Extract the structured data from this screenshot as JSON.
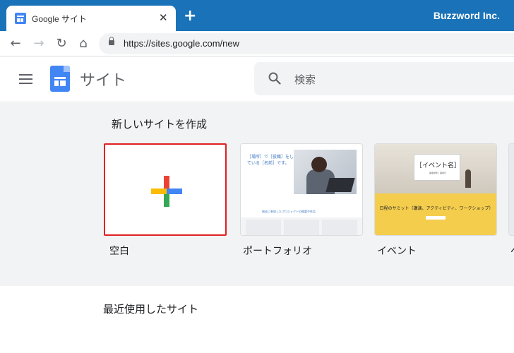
{
  "browser": {
    "tab_title": "Google サイト",
    "tab_close": "✕",
    "new_tab": "+",
    "profile_name": "Buzzword Inc.",
    "url": "https://sites.google.com/new",
    "nav": {
      "back": "←",
      "forward": "→",
      "reload": "↻",
      "home": "⌂"
    }
  },
  "app": {
    "title": "サイト",
    "search_placeholder": "検索"
  },
  "gallery": {
    "heading": "新しいサイトを作成",
    "templates": [
      {
        "label": "空白",
        "selected": true
      },
      {
        "label": "ポートフォリオ",
        "thumb_title": "［場所］で［役職］をしている［名前］です。",
        "thumb_caption": "過去に参加したプロジェクトの概要や作品"
      },
      {
        "label": "イベント",
        "thumb_title": "［イベント名］",
        "thumb_sub": "開催場所 | 開催日",
        "thumb_text": "日程のサミット（講演、アクティビティ、ワークショップ）"
      },
      {
        "label": "ペ"
      }
    ]
  },
  "recent": {
    "heading": "最近使用したサイト"
  }
}
